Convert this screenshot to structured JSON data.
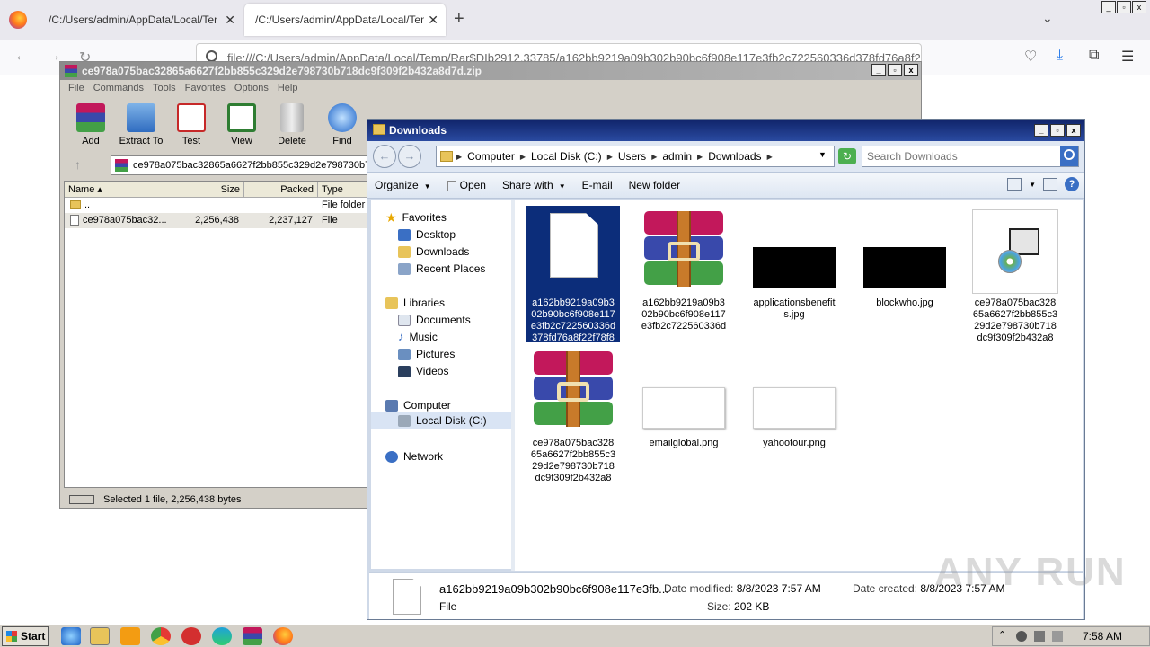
{
  "browser": {
    "tabs": [
      {
        "title": "/C:/Users/admin/AppData/Local/Temp/R",
        "active": false
      },
      {
        "title": "/C:/Users/admin/AppData/Local/Temp/R",
        "active": true
      }
    ],
    "url": "file:///C:/Users/admin/AppData/Local/Temp/Rar$DIb2912.33785/a162bb9219a09b302b90bc6f908e117e3fb2c722560336d378fd76a8f2",
    "sys_btns": [
      "_",
      "▫",
      "x"
    ]
  },
  "winrar": {
    "title": "ce978a075bac32865a6627f2bb855c329d2e798730b718dc9f309f2b432a8d7d.zip",
    "menu": [
      "File",
      "Commands",
      "Tools",
      "Favorites",
      "Options",
      "Help"
    ],
    "toolbar": [
      "Add",
      "Extract To",
      "Test",
      "View",
      "Delete",
      "Find"
    ],
    "path": "ce978a075bac32865a6627f2bb855c329d2e798730b7",
    "columns": [
      "Name",
      "Size",
      "Packed",
      "Type"
    ],
    "rows": [
      {
        "name": "..",
        "size": "",
        "packed": "",
        "type": "File folder"
      },
      {
        "name": "ce978a075bac32...",
        "size": "2,256,438",
        "packed": "2,237,127",
        "type": "File"
      }
    ],
    "status": "Selected 1 file, 2,256,438 bytes"
  },
  "explorer": {
    "title": "Downloads",
    "breadcrumbs": [
      "Computer",
      "Local Disk (C:)",
      "Users",
      "admin",
      "Downloads"
    ],
    "search_placeholder": "Search Downloads",
    "commands": [
      "Organize",
      "Open",
      "Share with",
      "E-mail",
      "New folder"
    ],
    "nav": {
      "favorites": "Favorites",
      "favorites_items": [
        "Desktop",
        "Downloads",
        "Recent Places"
      ],
      "libraries": "Libraries",
      "libraries_items": [
        "Documents",
        "Music",
        "Pictures",
        "Videos"
      ],
      "computer": "Computer",
      "computer_items": [
        "Local Disk (C:)"
      ],
      "network": "Network"
    },
    "files": [
      {
        "name": "a162bb9219a09b302b90bc6f908e117e3fb2c722560336d378fd76a8f22f78f8",
        "kind": "blank-doc",
        "selected": true
      },
      {
        "name": "a162bb9219a09b302b90bc6f908e117e3fb2c722560336d378fd76a8f22f7...",
        "kind": "rar"
      },
      {
        "name": "applicationsbenefits.jpg",
        "kind": "black-image"
      },
      {
        "name": "blockwho.jpg",
        "kind": "black-image"
      },
      {
        "name": "ce978a075bac32865a6627f2bb855c329d2e798730b718dc9f309f2b432a8d...",
        "kind": "setup"
      },
      {
        "name": "ce978a075bac32865a6627f2bb855c329d2e798730b718dc9f309f2b432a8d...",
        "kind": "rar"
      },
      {
        "name": "emailglobal.png",
        "kind": "white-image"
      },
      {
        "name": "yahootour.png",
        "kind": "white-image"
      }
    ],
    "details": {
      "name": "a162bb9219a09b302b90bc6f908e117e3fb...",
      "type": "File",
      "modified_label": "Date modified:",
      "modified": "8/8/2023 7:57 AM",
      "size_label": "Size:",
      "size": "202 KB",
      "created_label": "Date created:",
      "created": "8/8/2023 7:57 AM"
    }
  },
  "watermark": "ANY RUN",
  "taskbar": {
    "start": "Start",
    "clock": "7:58 AM"
  }
}
